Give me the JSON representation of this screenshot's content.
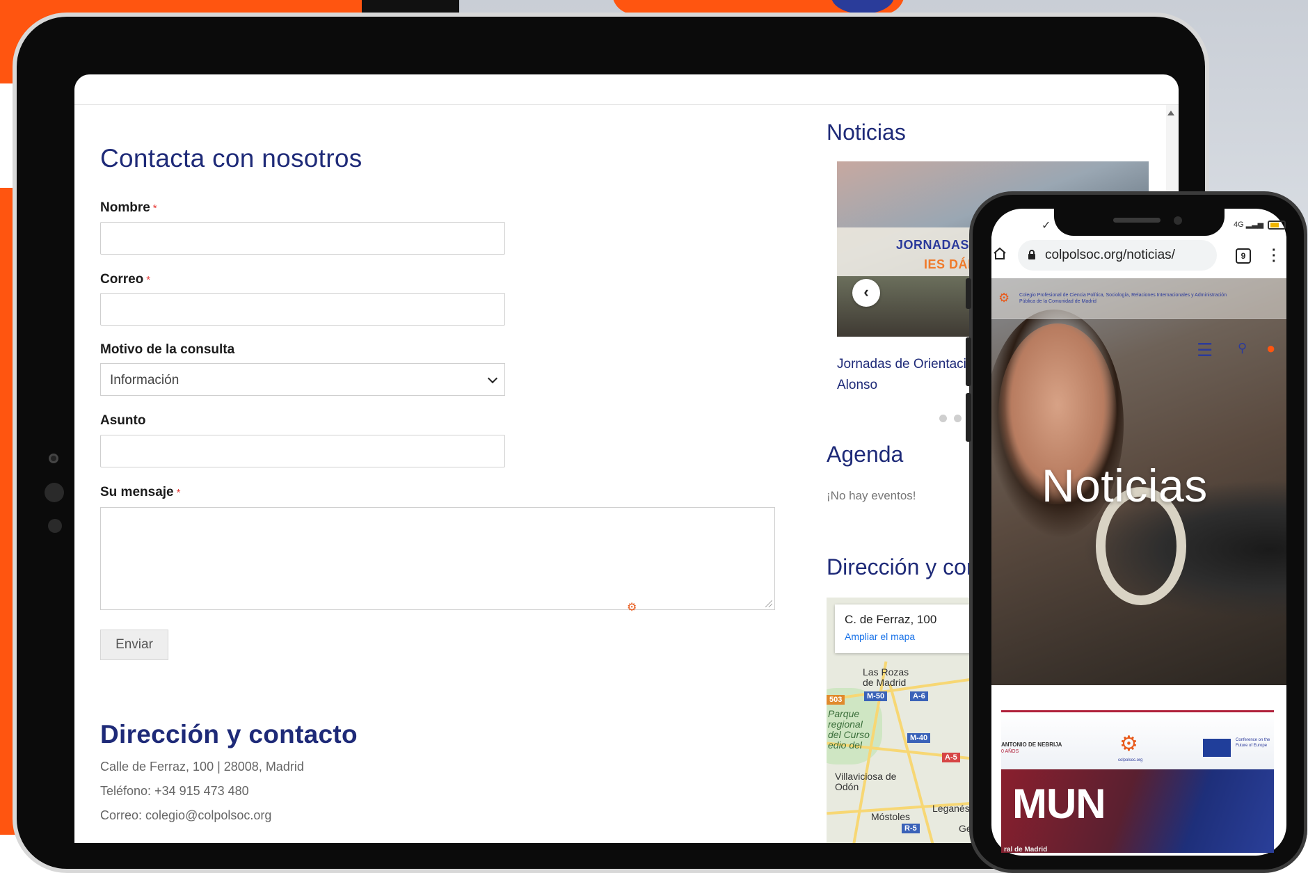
{
  "tablet_page": {
    "contact_title": "Contacta con nosotros",
    "required_mark": "*",
    "fields": {
      "nombre_label": "Nombre",
      "correo_label": "Correo",
      "motivo_label": "Motivo de la consulta",
      "motivo_value": "Información",
      "asunto_label": "Asunto",
      "mensaje_label": "Su mensaje"
    },
    "send_label": "Enviar",
    "direccion_title": "Dirección y contacto",
    "address_lines": [
      "Calle de Ferraz, 100 | 28008, Madrid",
      "Teléfono: +34 915 473 480",
      "Correo: colegio@colpolsoc.org"
    ],
    "sidebar": {
      "news_title": "Noticias",
      "news_image_line1": "JORNADAS DE",
      "news_image_line2": "IES DÁMA",
      "news_caption": "Jornadas de Orientació Alonso",
      "agenda_title": "Agenda",
      "no_events": "¡No hay eventos!",
      "direccion_title": "Dirección y cor",
      "map": {
        "address": "C. de Ferraz, 100",
        "enlarge_link": "Ampliar el mapa",
        "labels": {
          "las_rozas": "Las Rozas de Madrid",
          "parque": "Parque regional del Curso edio del",
          "villaviciosa": "Villaviciosa de Odón",
          "mostoles": "Móstoles",
          "leganes": "Leganés",
          "getafe": "Getaf"
        },
        "shields": {
          "m50": "M-50",
          "a6": "A-6",
          "m40": "M-40",
          "a5": "A-5",
          "r5": "R-5",
          "m503": "503"
        }
      }
    }
  },
  "phone": {
    "url": "colpolsoc.org/noticias/",
    "tab_count": "9",
    "status_right": "4G",
    "org_name": "Colegio Profesional de Ciencia Política, Sociología, Relaciones Internacionales y Administración Pública de la Comunidad de Madrid",
    "hero_title": "Noticias",
    "card": {
      "nebrija": "ANTONIO DE NEBRIJA",
      "anos": "0 AÑOS",
      "logo_caption": "colpolsoc.org",
      "eu_caption": "Conference on the Future of Europe",
      "mun": "MUN",
      "bottom_text": "ral de Madrid"
    }
  }
}
